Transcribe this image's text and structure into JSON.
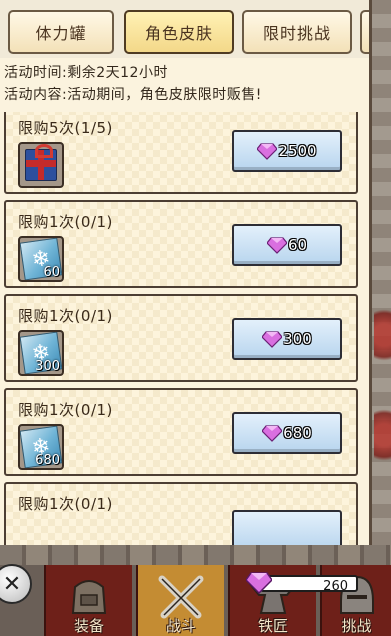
{
  "tabs": [
    {
      "label": "体力罐",
      "active": false
    },
    {
      "label": "角色皮肤",
      "active": true
    },
    {
      "label": "限时挑战",
      "active": false
    }
  ],
  "activity": {
    "time": "活动时间:剩余2天12小时",
    "content": "活动内容:活动期间，角色皮肤限时贩售!"
  },
  "items": [
    {
      "limit": "限购5次(1/5)",
      "icon": "gift-box-icon",
      "icon_count": "",
      "price": "2500"
    },
    {
      "limit": "限购1次(0/1)",
      "icon": "snowflake-card-icon",
      "icon_count": "60",
      "price": "60"
    },
    {
      "limit": "限购1次(0/1)",
      "icon": "snowflake-card-icon",
      "icon_count": "300",
      "price": "300"
    },
    {
      "limit": "限购1次(0/1)",
      "icon": "snowflake-card-icon",
      "icon_count": "680",
      "price": "680"
    },
    {
      "limit": "限购1次(0/1)",
      "icon": "snowflake-card-icon",
      "icon_count": "",
      "price": ""
    }
  ],
  "currency": {
    "gems": "260",
    "icon": "gem-icon"
  },
  "bottom_nav": [
    {
      "label": "装备",
      "icon": "backpack-icon",
      "selected": false
    },
    {
      "label": "战斗",
      "icon": "crossed-swords-icon",
      "selected": true
    },
    {
      "label": "铁匠",
      "icon": "anvil-icon",
      "selected": false
    },
    {
      "label": "挑战",
      "icon": "helmet-icon",
      "selected": false
    }
  ],
  "close_icon": "close-icon"
}
